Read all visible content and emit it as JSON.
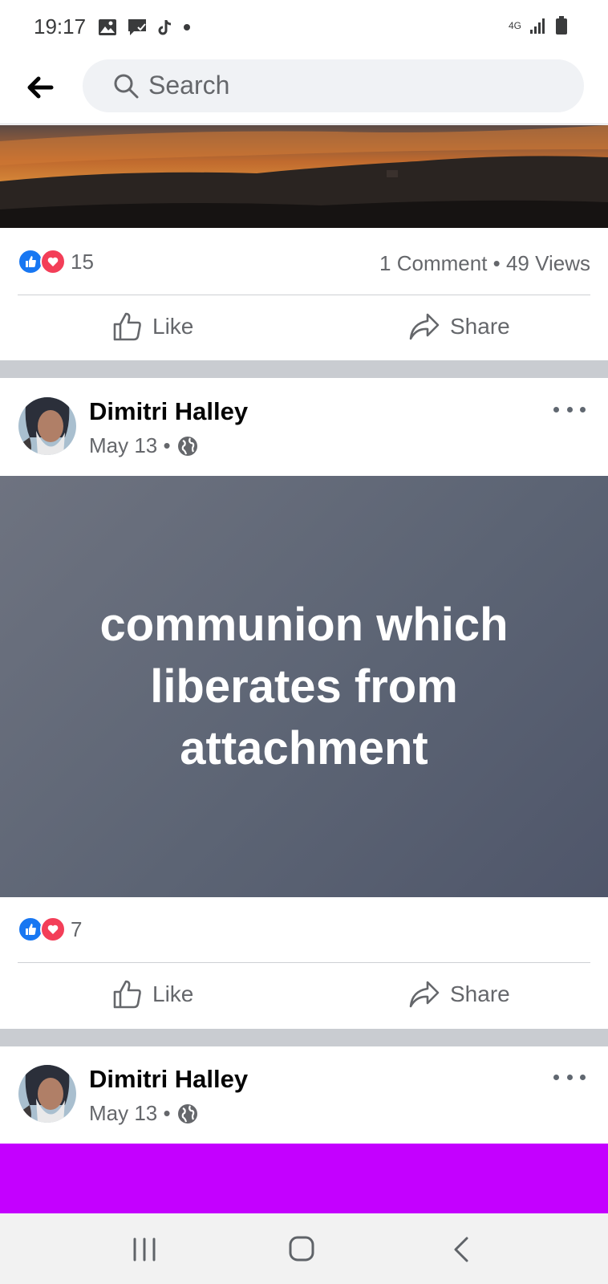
{
  "status_bar": {
    "time": "19:17",
    "network": "4G"
  },
  "search": {
    "placeholder": "Search"
  },
  "post1": {
    "reaction_count": "15",
    "comments_views": "1 Comment • 49 Views",
    "like_label": "Like",
    "share_label": "Share"
  },
  "post2": {
    "author": "Dimitri Halley",
    "date": "May 13 •",
    "text": "communion which liberates from attachment",
    "background": "#5c6474",
    "reaction_count": "7",
    "like_label": "Like",
    "share_label": "Share"
  },
  "post3": {
    "author": "Dimitri Halley",
    "date": "May 13 •",
    "background": "#c400ff"
  },
  "colors": {
    "like_blue": "#1877f2",
    "love_red": "#f33e58",
    "text_secondary": "#65676b"
  }
}
